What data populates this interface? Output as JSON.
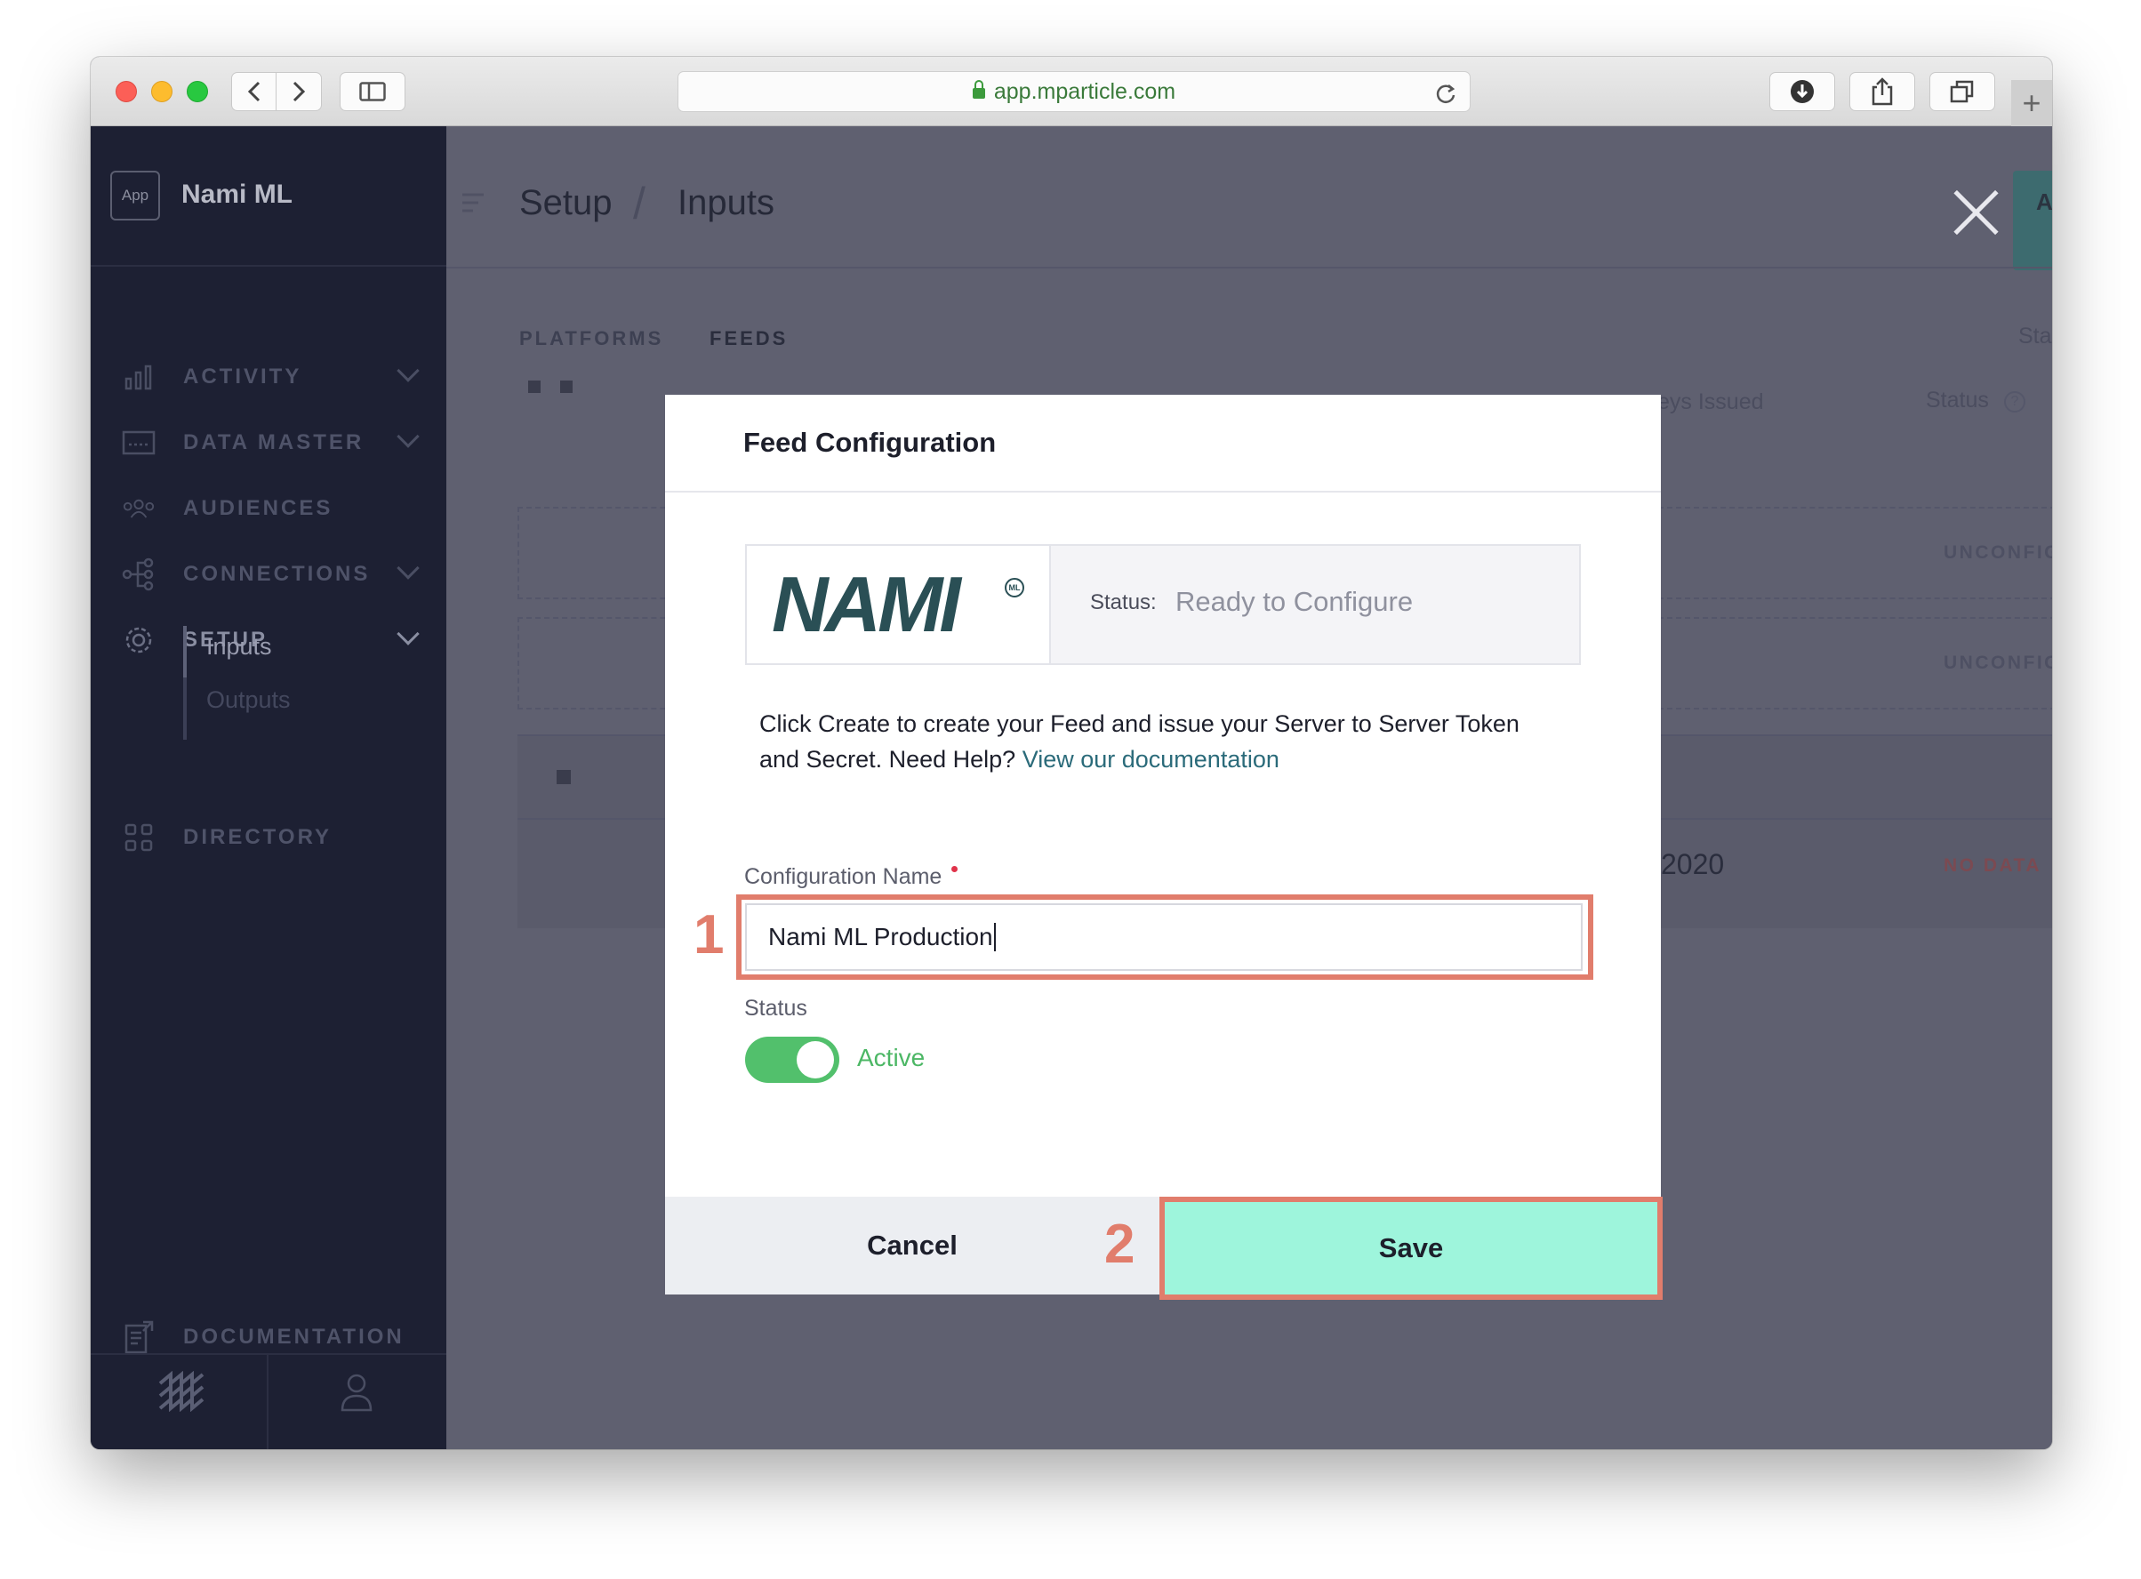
{
  "browser": {
    "url": "app.mparticle.com"
  },
  "sidebar": {
    "app_badge": "App",
    "app_name": "Nami ML",
    "items": [
      {
        "label": "ACTIVITY",
        "icon": "bar-chart-icon"
      },
      {
        "label": "DATA MASTER",
        "icon": "data-master-icon"
      },
      {
        "label": "AUDIENCES",
        "icon": "people-icon"
      },
      {
        "label": "CONNECTIONS",
        "icon": "connections-icon"
      },
      {
        "label": "SETUP",
        "icon": "gear-icon"
      },
      {
        "label": "DIRECTORY",
        "icon": "grid-icon"
      }
    ],
    "setup_sub": [
      "Inputs",
      "Outputs"
    ],
    "documentation": "DOCUMENTATION"
  },
  "header": {
    "breadcrumb_root": "Setup",
    "breadcrumb_sep": "/",
    "breadcrumb_current": "Inputs",
    "action_button_partial": "A"
  },
  "background": {
    "tabs": [
      "PLATFORMS",
      "FEEDS"
    ],
    "col_partial_keys": "eys Issued",
    "col_status": "Status",
    "col_right_partial": "Sta",
    "rows": [
      {
        "badge": "UNCONFIGURED"
      },
      {
        "badge": "UNCONFIGURED"
      },
      {
        "date_partial": "2020",
        "badge": "NO DATA"
      }
    ]
  },
  "modal": {
    "title": "Feed Configuration",
    "logo_text": "NAMI",
    "logo_mark": "ML",
    "status_label": "Status:",
    "status_value": "Ready to Configure",
    "description": "Click Create to create your Feed and issue your Server to Server Token and Secret. Need Help? ",
    "doc_link": "View our documentation",
    "config_name_label": "Configuration Name",
    "config_name_value": "Nami ML Production",
    "status_field_label": "Status",
    "toggle_label": "Active",
    "cancel_label": "Cancel",
    "save_label": "Save"
  },
  "annotations": {
    "step1": "1",
    "step2": "2"
  },
  "colors": {
    "sidebar_bg": "#1d2033",
    "overlay_bg": "#5f6070",
    "highlight": "#e17d6c",
    "save_bg": "#9ef5dc",
    "toggle_on": "#52c06c",
    "link": "#2b6b7a"
  }
}
